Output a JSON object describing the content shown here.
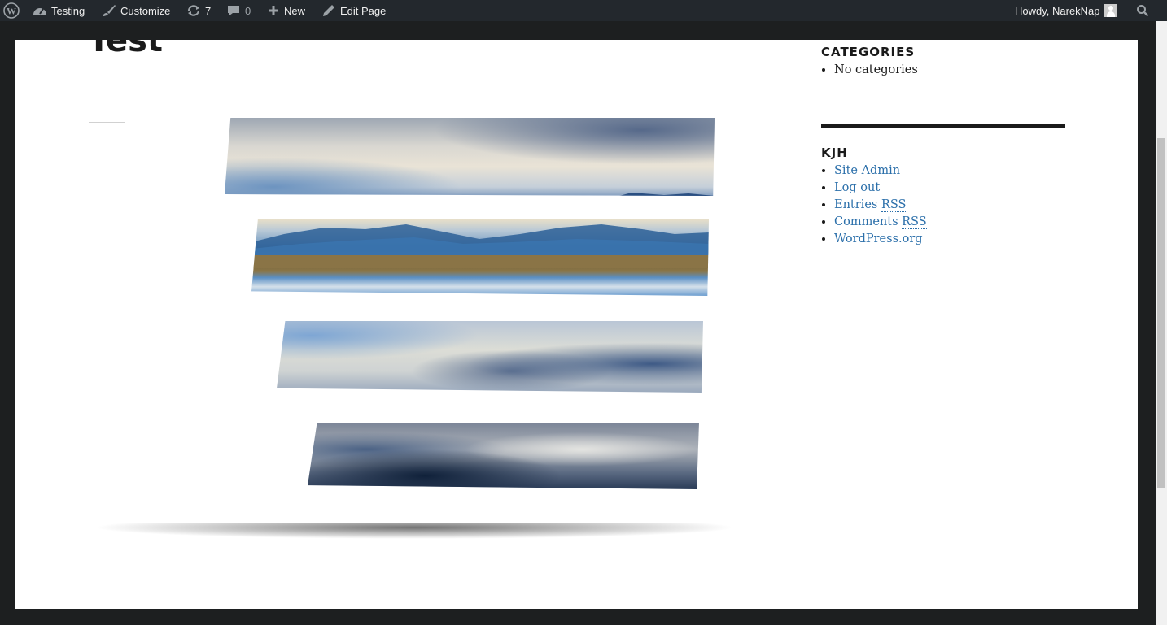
{
  "adminbar": {
    "site_name": "Testing",
    "customize_label": "Customize",
    "updates_count": "7",
    "comments_count": "0",
    "new_label": "New",
    "edit_label": "Edit Page",
    "howdy": "Howdy, NarekNap"
  },
  "page": {
    "title": "Test"
  },
  "sidebar": {
    "categories_title": "CATEGORIES",
    "categories_item": "No categories",
    "meta_title": "KJH",
    "meta_items": [
      "Site Admin",
      "Log out",
      "Entries",
      "Comments",
      "WordPress.org"
    ],
    "rss_label": "RSS"
  },
  "colors": {
    "admin_bar": "#23282d",
    "link": "#2b6faa",
    "background": "#1d1f20"
  }
}
